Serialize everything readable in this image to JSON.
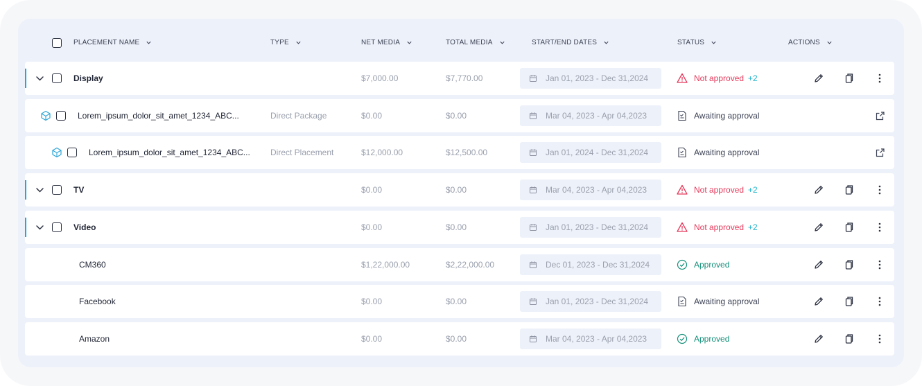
{
  "header": {
    "select_all": "",
    "columns": [
      {
        "label": "PLACEMENT NAME"
      },
      {
        "label": "TYPE"
      },
      {
        "label": "NET MEDIA"
      },
      {
        "label": "TOTAL MEDIA"
      },
      {
        "label": "START/END DATES"
      },
      {
        "label": "STATUS"
      },
      {
        "label": "ACTIONS"
      }
    ]
  },
  "rows": [
    {
      "kind": "group",
      "name": "Display",
      "type": "",
      "net": "$7,000.00",
      "total": "$7,770.00",
      "dates": "Jan 01, 2023 - Dec 31,2024",
      "status": "Not approved",
      "status_extra": "+2",
      "status_kind": "error"
    },
    {
      "kind": "child",
      "name": "Lorem_ipsum_dolor_sit_amet_1234_ABC...",
      "type": "Direct Package",
      "net": "$0.00",
      "total": "$0.00",
      "dates": "Mar 04, 2023 - Apr 04,2023",
      "status": "Awaiting approval",
      "status_kind": "pending"
    },
    {
      "kind": "grandchild",
      "name": "Lorem_ipsum_dolor_sit_amet_1234_ABC...",
      "type": "Direct Placement",
      "net": "$12,000.00",
      "total": "$12,500.00",
      "dates": "Jan 01, 2024 - Dec 31,2024",
      "status": "Awaiting approval",
      "status_kind": "pending"
    },
    {
      "kind": "group",
      "name": "TV",
      "type": "",
      "net": "$0.00",
      "total": "$0.00",
      "dates": "Mar 04, 2023 - Apr 04,2023",
      "status": "Not approved",
      "status_extra": "+2",
      "status_kind": "error"
    },
    {
      "kind": "group",
      "name": "Video",
      "type": "",
      "net": "$0.00",
      "total": "$0.00",
      "dates": "Jan 01, 2023 - Dec 31,2024",
      "status": "Not approved",
      "status_extra": "+2",
      "status_kind": "error"
    },
    {
      "kind": "leaf",
      "name": "CM360",
      "type": "",
      "net": "$1,22,000.00",
      "total": "$2,22,000.00",
      "dates": "Dec 01, 2023 - Dec 31,2024",
      "status": "Approved",
      "status_kind": "ok"
    },
    {
      "kind": "leaf",
      "name": "Facebook",
      "type": "",
      "net": "$0.00",
      "total": "$0.00",
      "dates": "Jan 01, 2023 - Dec 31,2024",
      "status": "Awaiting approval",
      "status_kind": "pending"
    },
    {
      "kind": "leaf",
      "name": "Amazon",
      "type": "",
      "net": "$0.00",
      "total": "$0.00",
      "dates": "Mar 04, 2023 - Apr 04,2023",
      "status": "Approved",
      "status_kind": "ok"
    }
  ],
  "icons": {
    "error": "warning-triangle-icon",
    "pending": "document-pending-icon",
    "ok": "check-circle-icon",
    "edit": "pencil-icon",
    "copy": "copy-icon",
    "more": "kebab-menu-icon",
    "share": "share-icon",
    "package": "cube-icon",
    "calendar": "calendar-icon"
  },
  "colors": {
    "accent": "#2aa4d6",
    "error": "#e5385a",
    "extra": "#22b3c9",
    "approved": "#15907a",
    "muted": "#9aa0ad",
    "panel": "#edf1fa"
  }
}
